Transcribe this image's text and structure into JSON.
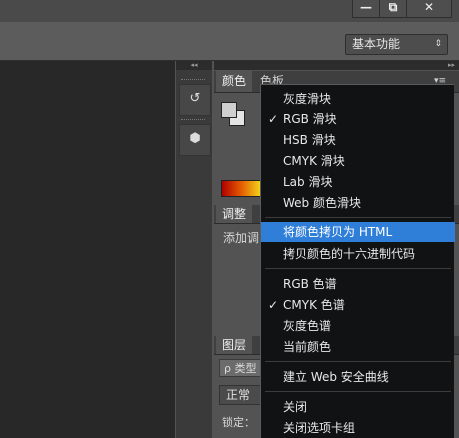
{
  "window": {
    "minimize_label": "—",
    "maximize_label": "⧉",
    "close_label": "✕"
  },
  "optionsbar": {
    "workspace_value": "基本功能",
    "workspace_arrow": "⇕"
  },
  "dock": {
    "collapse_glyph": "◂◂",
    "expand_glyph": "▸▸",
    "history_glyph": "↺",
    "cube_glyph": "⬢"
  },
  "color_panel": {
    "tabs": [
      "颜色",
      "色板"
    ],
    "menu_glyph": "▾≡"
  },
  "adjust_panel": {
    "tab": "调整",
    "add_text": "添加调"
  },
  "layers_panel": {
    "tab": "图层",
    "search_placeholder": "ρ 类型",
    "blend_mode": "正常",
    "lock_label": "锁定："
  },
  "context_menu": {
    "items": [
      {
        "label": "灰度滑块",
        "checked": false
      },
      {
        "label": "RGB 滑块",
        "checked": true
      },
      {
        "label": "HSB 滑块",
        "checked": false
      },
      {
        "label": "CMYK 滑块",
        "checked": false
      },
      {
        "label": "Lab 滑块",
        "checked": false
      },
      {
        "label": "Web 颜色滑块",
        "checked": false
      },
      {
        "label": "将颜色拷贝为 HTML",
        "checked": false,
        "highlighted": true
      },
      {
        "label": "拷贝颜色的十六进制代码",
        "checked": false
      },
      {
        "label": "RGB 色谱",
        "checked": false
      },
      {
        "label": "CMYK 色谱",
        "checked": true
      },
      {
        "label": "灰度色谱",
        "checked": false
      },
      {
        "label": "当前颜色",
        "checked": false
      },
      {
        "label": "建立 Web 安全曲线",
        "checked": false
      },
      {
        "label": "关闭",
        "checked": false
      },
      {
        "label": "关闭选项卡组",
        "checked": false
      }
    ],
    "check_glyph": "✓",
    "highlight_color": "#2f7ed8"
  }
}
